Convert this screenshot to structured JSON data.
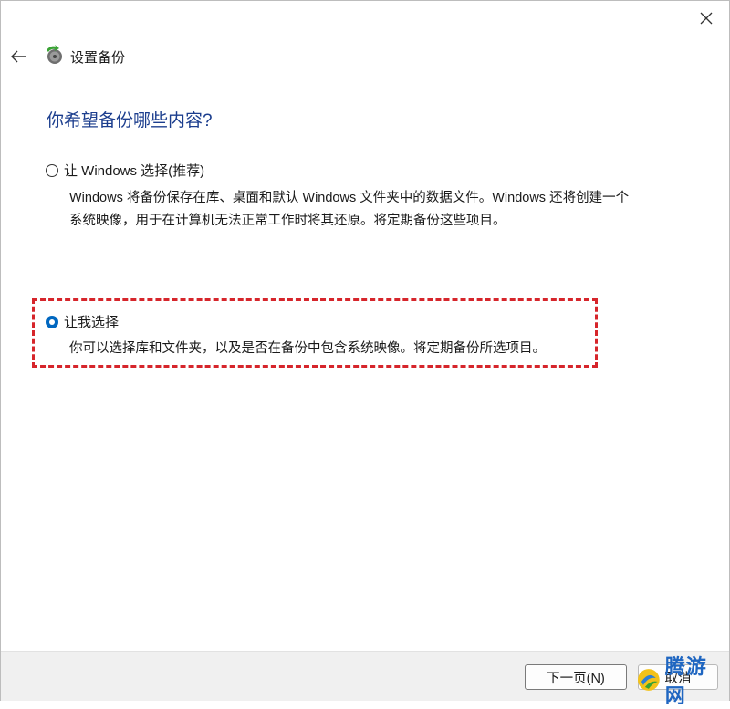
{
  "header": {
    "title": "设置备份",
    "back_icon": "arrow-left-icon",
    "app_icon": "backup-icon"
  },
  "window": {
    "close_icon": "close-icon"
  },
  "main": {
    "heading": "你希望备份哪些内容?",
    "options": [
      {
        "label": "让 Windows 选择(推荐)",
        "checked": false,
        "description_lines": [
          "Windows 将备份保存在库、桌面和默认 Windows 文件夹中的数据文件。Windows 还将创建一个",
          "系统映像，用于在计算机无法正常工作时将其还原。将定期备份这些项目。"
        ]
      },
      {
        "label": "让我选择",
        "checked": true,
        "description_lines": [
          "你可以选择库和文件夹，以及是否在备份中包含系统映像。将定期备份所选项目。"
        ]
      }
    ],
    "highlight_color": "#d6252b"
  },
  "footer": {
    "next_label": "下一页(N)",
    "cancel_label": "取消"
  },
  "watermark": {
    "text": "腾游网"
  }
}
